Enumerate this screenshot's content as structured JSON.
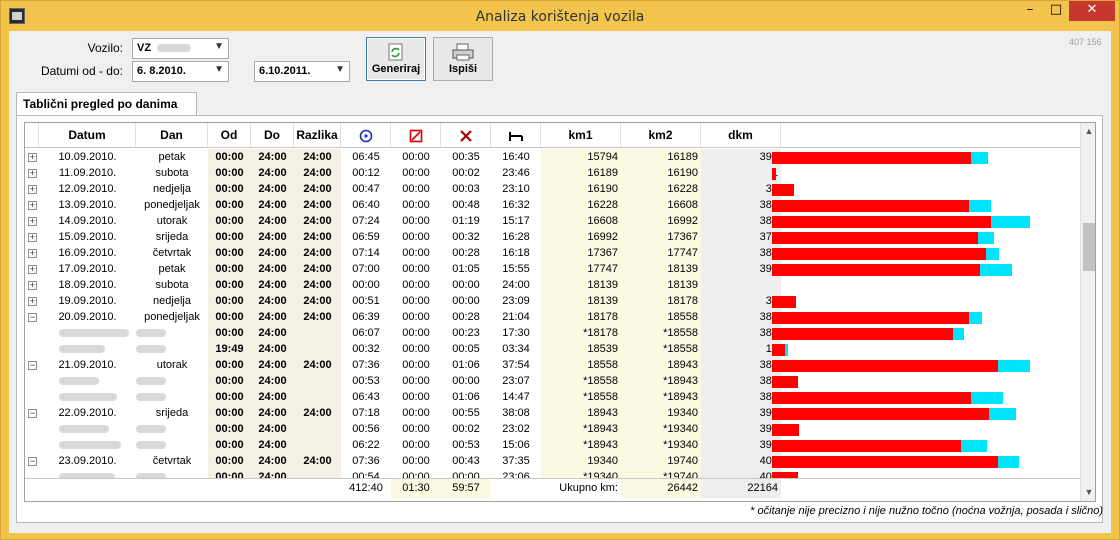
{
  "window": {
    "title": "Analiza korištenja vozila",
    "min": "–",
    "max": "□",
    "close": "✕"
  },
  "form": {
    "vozilo_label": "Vozilo:",
    "vozilo_value": "VZ",
    "datumi_label": "Datumi od - do:",
    "date_from": "6.  8.2010.",
    "date_to": "6.10.2011.",
    "generate_label": "Generiraj",
    "print_label": "Ispiši",
    "corner_number": "407 156"
  },
  "tab": {
    "label": "Tablični pregled po danima"
  },
  "columns": {
    "datum": "Datum",
    "dan": "Dan",
    "od": "Od",
    "do": "Do",
    "razlika": "Razlika",
    "km1": "km1",
    "km2": "km2",
    "dkm": "dkm"
  },
  "rows": [
    {
      "type": "day",
      "exp": "+",
      "datum": "10.09.2010.",
      "dan": "petak",
      "od": "00:00",
      "do": "24:00",
      "raz": "24:00",
      "t1": "06:45",
      "t2": "00:00",
      "t3": "00:35",
      "t4": "16:40",
      "km1": "15794",
      "km2": "16189",
      "dkm": "395",
      "red": 199,
      "cyan": 17
    },
    {
      "type": "day",
      "exp": "+",
      "datum": "11.09.2010.",
      "dan": "subota",
      "od": "00:00",
      "do": "24:00",
      "raz": "24:00",
      "t1": "00:12",
      "t2": "00:00",
      "t3": "00:02",
      "t4": "23:46",
      "km1": "16189",
      "km2": "16190",
      "dkm": "1",
      "red": 4,
      "cyan": 0
    },
    {
      "type": "day",
      "exp": "+",
      "datum": "12.09.2010.",
      "dan": "nedjelja",
      "od": "00:00",
      "do": "24:00",
      "raz": "24:00",
      "t1": "00:47",
      "t2": "00:00",
      "t3": "00:03",
      "t4": "23:10",
      "km1": "16190",
      "km2": "16228",
      "dkm": "38",
      "red": 22,
      "cyan": 0
    },
    {
      "type": "day",
      "exp": "+",
      "datum": "13.09.2010.",
      "dan": "ponedjeljak",
      "od": "00:00",
      "do": "24:00",
      "raz": "24:00",
      "t1": "06:40",
      "t2": "00:00",
      "t3": "00:48",
      "t4": "16:32",
      "km1": "16228",
      "km2": "16608",
      "dkm": "380",
      "red": 197,
      "cyan": 22
    },
    {
      "type": "day",
      "exp": "+",
      "datum": "14.09.2010.",
      "dan": "utorak",
      "od": "00:00",
      "do": "24:00",
      "raz": "24:00",
      "t1": "07:24",
      "t2": "00:00",
      "t3": "01:19",
      "t4": "15:17",
      "km1": "16608",
      "km2": "16992",
      "dkm": "384",
      "red": 219,
      "cyan": 39
    },
    {
      "type": "day",
      "exp": "+",
      "datum": "15.09.2010.",
      "dan": "srijeda",
      "od": "00:00",
      "do": "24:00",
      "raz": "24:00",
      "t1": "06:59",
      "t2": "00:00",
      "t3": "00:32",
      "t4": "16:28",
      "km1": "16992",
      "km2": "17367",
      "dkm": "375",
      "red": 206,
      "cyan": 16
    },
    {
      "type": "day",
      "exp": "+",
      "datum": "16.09.2010.",
      "dan": "četvrtak",
      "od": "00:00",
      "do": "24:00",
      "raz": "24:00",
      "t1": "07:14",
      "t2": "00:00",
      "t3": "00:28",
      "t4": "16:18",
      "km1": "17367",
      "km2": "17747",
      "dkm": "380",
      "red": 214,
      "cyan": 13
    },
    {
      "type": "day",
      "exp": "+",
      "datum": "17.09.2010.",
      "dan": "petak",
      "od": "00:00",
      "do": "24:00",
      "raz": "24:00",
      "t1": "07:00",
      "t2": "00:00",
      "t3": "01:05",
      "t4": "15:55",
      "km1": "17747",
      "km2": "18139",
      "dkm": "392",
      "red": 208,
      "cyan": 32
    },
    {
      "type": "day",
      "exp": "+",
      "datum": "18.09.2010.",
      "dan": "subota",
      "od": "00:00",
      "do": "24:00",
      "raz": "24:00",
      "t1": "00:00",
      "t2": "00:00",
      "t3": "00:00",
      "t4": "24:00",
      "km1": "18139",
      "km2": "18139",
      "dkm": "",
      "red": 0,
      "cyan": 0
    },
    {
      "type": "day",
      "exp": "+",
      "datum": "19.09.2010.",
      "dan": "nedjelja",
      "od": "00:00",
      "do": "24:00",
      "raz": "24:00",
      "t1": "00:51",
      "t2": "00:00",
      "t3": "00:00",
      "t4": "23:09",
      "km1": "18139",
      "km2": "18178",
      "dkm": "39",
      "red": 24,
      "cyan": 0
    },
    {
      "type": "day",
      "exp": "−",
      "datum": "20.09.2010.",
      "dan": "ponedjeljak",
      "od": "00:00",
      "do": "24:00",
      "raz": "24:00",
      "t1": "06:39",
      "t2": "00:00",
      "t3": "00:28",
      "t4": "21:04",
      "km1": "18178",
      "km2": "18558",
      "dkm": "380",
      "red": 197,
      "cyan": 13
    },
    {
      "type": "sub",
      "od": "00:00",
      "do": "24:00",
      "raz": "",
      "t1": "06:07",
      "t2": "00:00",
      "t3": "00:23",
      "t4": "17:30",
      "km1": "*18178",
      "km2": "*18558",
      "dkm": "380",
      "red": 181,
      "cyan": 11
    },
    {
      "type": "sub",
      "od": "19:49",
      "do": "24:00",
      "raz": "",
      "t1": "00:32",
      "t2": "00:00",
      "t3": "00:05",
      "t4": "03:34",
      "km1": "18539",
      "km2": "*18558",
      "dkm": "19",
      "red": 13,
      "cyan": 3
    },
    {
      "type": "day",
      "exp": "−",
      "datum": "21.09.2010.",
      "dan": "utorak",
      "od": "00:00",
      "do": "24:00",
      "raz": "24:00",
      "t1": "07:36",
      "t2": "00:00",
      "t3": "01:06",
      "t4": "37:54",
      "km1": "18558",
      "km2": "18943",
      "dkm": "385",
      "red": 226,
      "cyan": 32
    },
    {
      "type": "sub",
      "od": "00:00",
      "do": "24:00",
      "raz": "",
      "t1": "00:53",
      "t2": "00:00",
      "t3": "00:00",
      "t4": "23:07",
      "km1": "*18558",
      "km2": "*18943",
      "dkm": "385",
      "red": 26,
      "cyan": 0
    },
    {
      "type": "sub",
      "od": "00:00",
      "do": "24:00",
      "raz": "",
      "t1": "06:43",
      "t2": "00:00",
      "t3": "01:06",
      "t4": "14:47",
      "km1": "*18558",
      "km2": "*18943",
      "dkm": "385",
      "red": 199,
      "cyan": 32
    },
    {
      "type": "day",
      "exp": "−",
      "datum": "22.09.2010.",
      "dan": "srijeda",
      "od": "00:00",
      "do": "24:00",
      "raz": "24:00",
      "t1": "07:18",
      "t2": "00:00",
      "t3": "00:55",
      "t4": "38:08",
      "km1": "18943",
      "km2": "19340",
      "dkm": "397",
      "red": 217,
      "cyan": 27
    },
    {
      "type": "sub",
      "od": "00:00",
      "do": "24:00",
      "raz": "",
      "t1": "00:56",
      "t2": "00:00",
      "t3": "00:02",
      "t4": "23:02",
      "km1": "*18943",
      "km2": "*19340",
      "dkm": "397",
      "red": 27,
      "cyan": 0
    },
    {
      "type": "sub",
      "od": "00:00",
      "do": "24:00",
      "raz": "",
      "t1": "06:22",
      "t2": "00:00",
      "t3": "00:53",
      "t4": "15:06",
      "km1": "*18943",
      "km2": "*19340",
      "dkm": "397",
      "red": 189,
      "cyan": 26
    },
    {
      "type": "day",
      "exp": "−",
      "datum": "23.09.2010.",
      "dan": "četvrtak",
      "od": "00:00",
      "do": "24:00",
      "raz": "24:00",
      "t1": "07:36",
      "t2": "00:00",
      "t3": "00:43",
      "t4": "37:35",
      "km1": "19340",
      "km2": "19740",
      "dkm": "400",
      "red": 226,
      "cyan": 21
    },
    {
      "type": "sub",
      "od": "00:00",
      "do": "24:00",
      "raz": "",
      "t1": "00:54",
      "t2": "00:00",
      "t3": "00:00",
      "t4": "23:06",
      "km1": "*19340",
      "km2": "*19740",
      "dkm": "400",
      "red": 26,
      "cyan": 0
    }
  ],
  "footer": {
    "t1": "412:40",
    "t2": "01:30",
    "t3": "59:57",
    "total_label": "Ukupno km:",
    "km2": "26442",
    "dkm": "22164"
  },
  "note": "* očitanje nije precizno i nije nužno točno (noćna vožnja, posada i slično)",
  "colors": {
    "bar_driving": "#ff0000",
    "bar_other": "#00e5ff",
    "title_bar": "#f3c44c"
  },
  "icons": {
    "clock": "clock-icon",
    "rest": "rest-icon",
    "work": "work-icon",
    "bed": "bed-icon"
  }
}
